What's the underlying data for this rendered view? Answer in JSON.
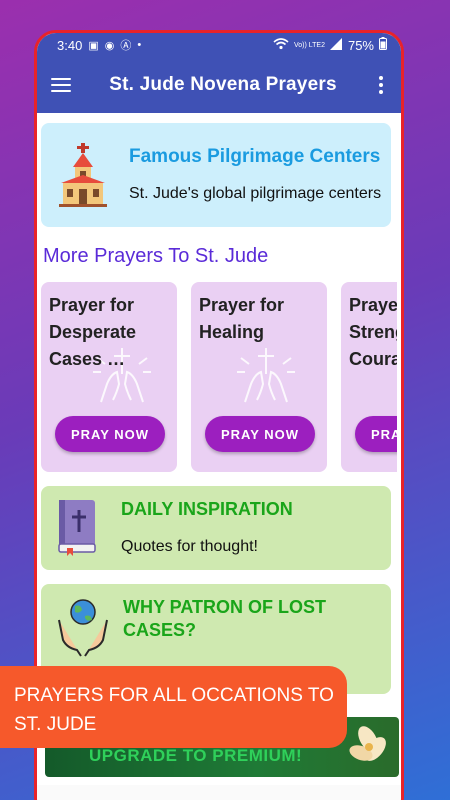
{
  "status": {
    "time": "3:40",
    "battery": "75%",
    "network": "Vo)) LTE2"
  },
  "appbar": {
    "title": "St. Jude Novena Prayers"
  },
  "pilgrimage": {
    "title": "Famous Pilgrimage Centers",
    "subtitle": "St. Jude's global pilgrimage centers"
  },
  "section_title": "More Prayers To St. Jude",
  "prayers": [
    {
      "title": "Prayer for Desperate Cases …",
      "button": "PRAY NOW"
    },
    {
      "title": "Prayer for Healing",
      "button": "PRAY NOW"
    },
    {
      "title": "Prayer for Strength Courage …",
      "button": "PRAY NOW"
    }
  ],
  "daily": {
    "title": "DAILY INSPIRATION",
    "subtitle": "Quotes for thought!"
  },
  "patron": {
    "title": "WHY PATRON OF LOST CASES?"
  },
  "banner": {
    "text": "PRAYERS FOR ALL OCCATIONS TO ST. JUDE"
  },
  "promo": {
    "text": "UPGRADE TO PREMIUM!"
  },
  "colors": {
    "appbar": "#3f51b5",
    "card_blue": "#cdeffc",
    "card_purple": "#ead0f3",
    "card_green": "#cfe9b0",
    "button": "#9c1fbf",
    "banner": "#f6592b"
  },
  "icons": [
    "menu-icon",
    "more-vert-icon",
    "church-icon",
    "praying-hands-icon",
    "bible-icon",
    "globe-hands-icon",
    "wifi-icon",
    "signal-icon",
    "battery-icon"
  ]
}
